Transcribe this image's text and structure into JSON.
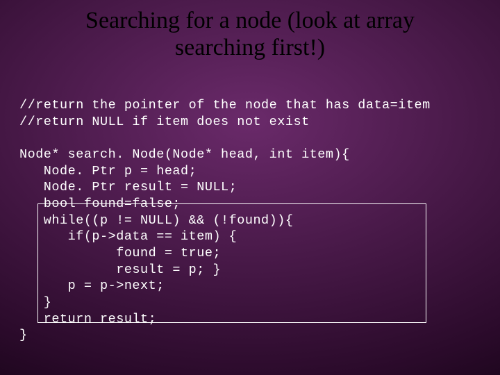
{
  "title_line1": "Searching for a node (look at array",
  "title_line2": "searching first!)",
  "code": {
    "c1": "//return the pointer of the node that has data=item",
    "c2": "//return NULL if item does not exist",
    "blank1": "",
    "l1": "Node* search. Node(Node* head, int item){",
    "l2": "   Node. Ptr p = head;",
    "l3": "   Node. Ptr result = NULL;",
    "l4": "   bool found=false;",
    "l5": "   while((p != NULL) && (!found)){",
    "l6": "      if(p->data == item) {",
    "l7": "            found = true;",
    "l8": "            result = p; }",
    "l9": "      p = p->next;",
    "l10": "   }",
    "l11": "   return result;",
    "l12": "}"
  }
}
